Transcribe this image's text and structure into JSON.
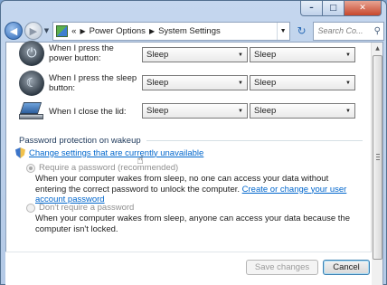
{
  "window": {
    "caption": {
      "minimize": "–",
      "maximize": "□",
      "close": "✕"
    }
  },
  "nav": {
    "back_glyph": "◀",
    "forward_glyph": "▶",
    "breadcrumb": [
      "«",
      "Power Options",
      "System Settings"
    ],
    "search_placeholder": "Search Co..."
  },
  "icons": {
    "power": "⏻",
    "sleep": "☾",
    "search": "⚲",
    "refresh": "↻",
    "dropdown": "▼",
    "cursor": "☝"
  },
  "settings": {
    "rows": [
      {
        "label": "When I press the power button:",
        "battery": "Sleep",
        "plugged": "Sleep"
      },
      {
        "label": "When I press the sleep button:",
        "battery": "Sleep",
        "plugged": "Sleep"
      },
      {
        "label": "When I close the lid:",
        "battery": "Sleep",
        "plugged": "Sleep"
      }
    ]
  },
  "password": {
    "section_title": "Password protection on wakeup",
    "change_link": "Change settings that are currently unavailable",
    "require": {
      "label": "Require a password (recommended)",
      "description": "When your computer wakes from sleep, no one can access your data without entering the correct password to unlock the computer.",
      "link": "Create or change your user account password"
    },
    "dont_require": {
      "label": "Don't require a password",
      "description": "When your computer wakes from sleep, anyone can access your data because the computer isn't locked."
    }
  },
  "buttons": {
    "save": "Save changes",
    "cancel": "Cancel"
  }
}
